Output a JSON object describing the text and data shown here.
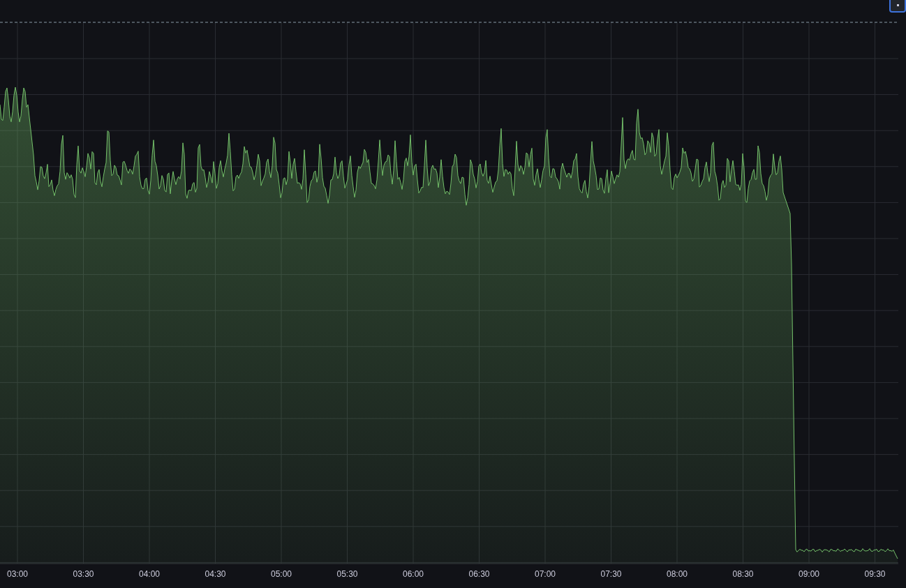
{
  "time_axis": {
    "tick_labels": [
      "03:00",
      "03:30",
      "04:00",
      "04:30",
      "05:00",
      "05:30",
      "06:00",
      "06:30",
      "07:00",
      "07:30",
      "08:00",
      "08:30",
      "09:00",
      "09:30"
    ]
  }
}
